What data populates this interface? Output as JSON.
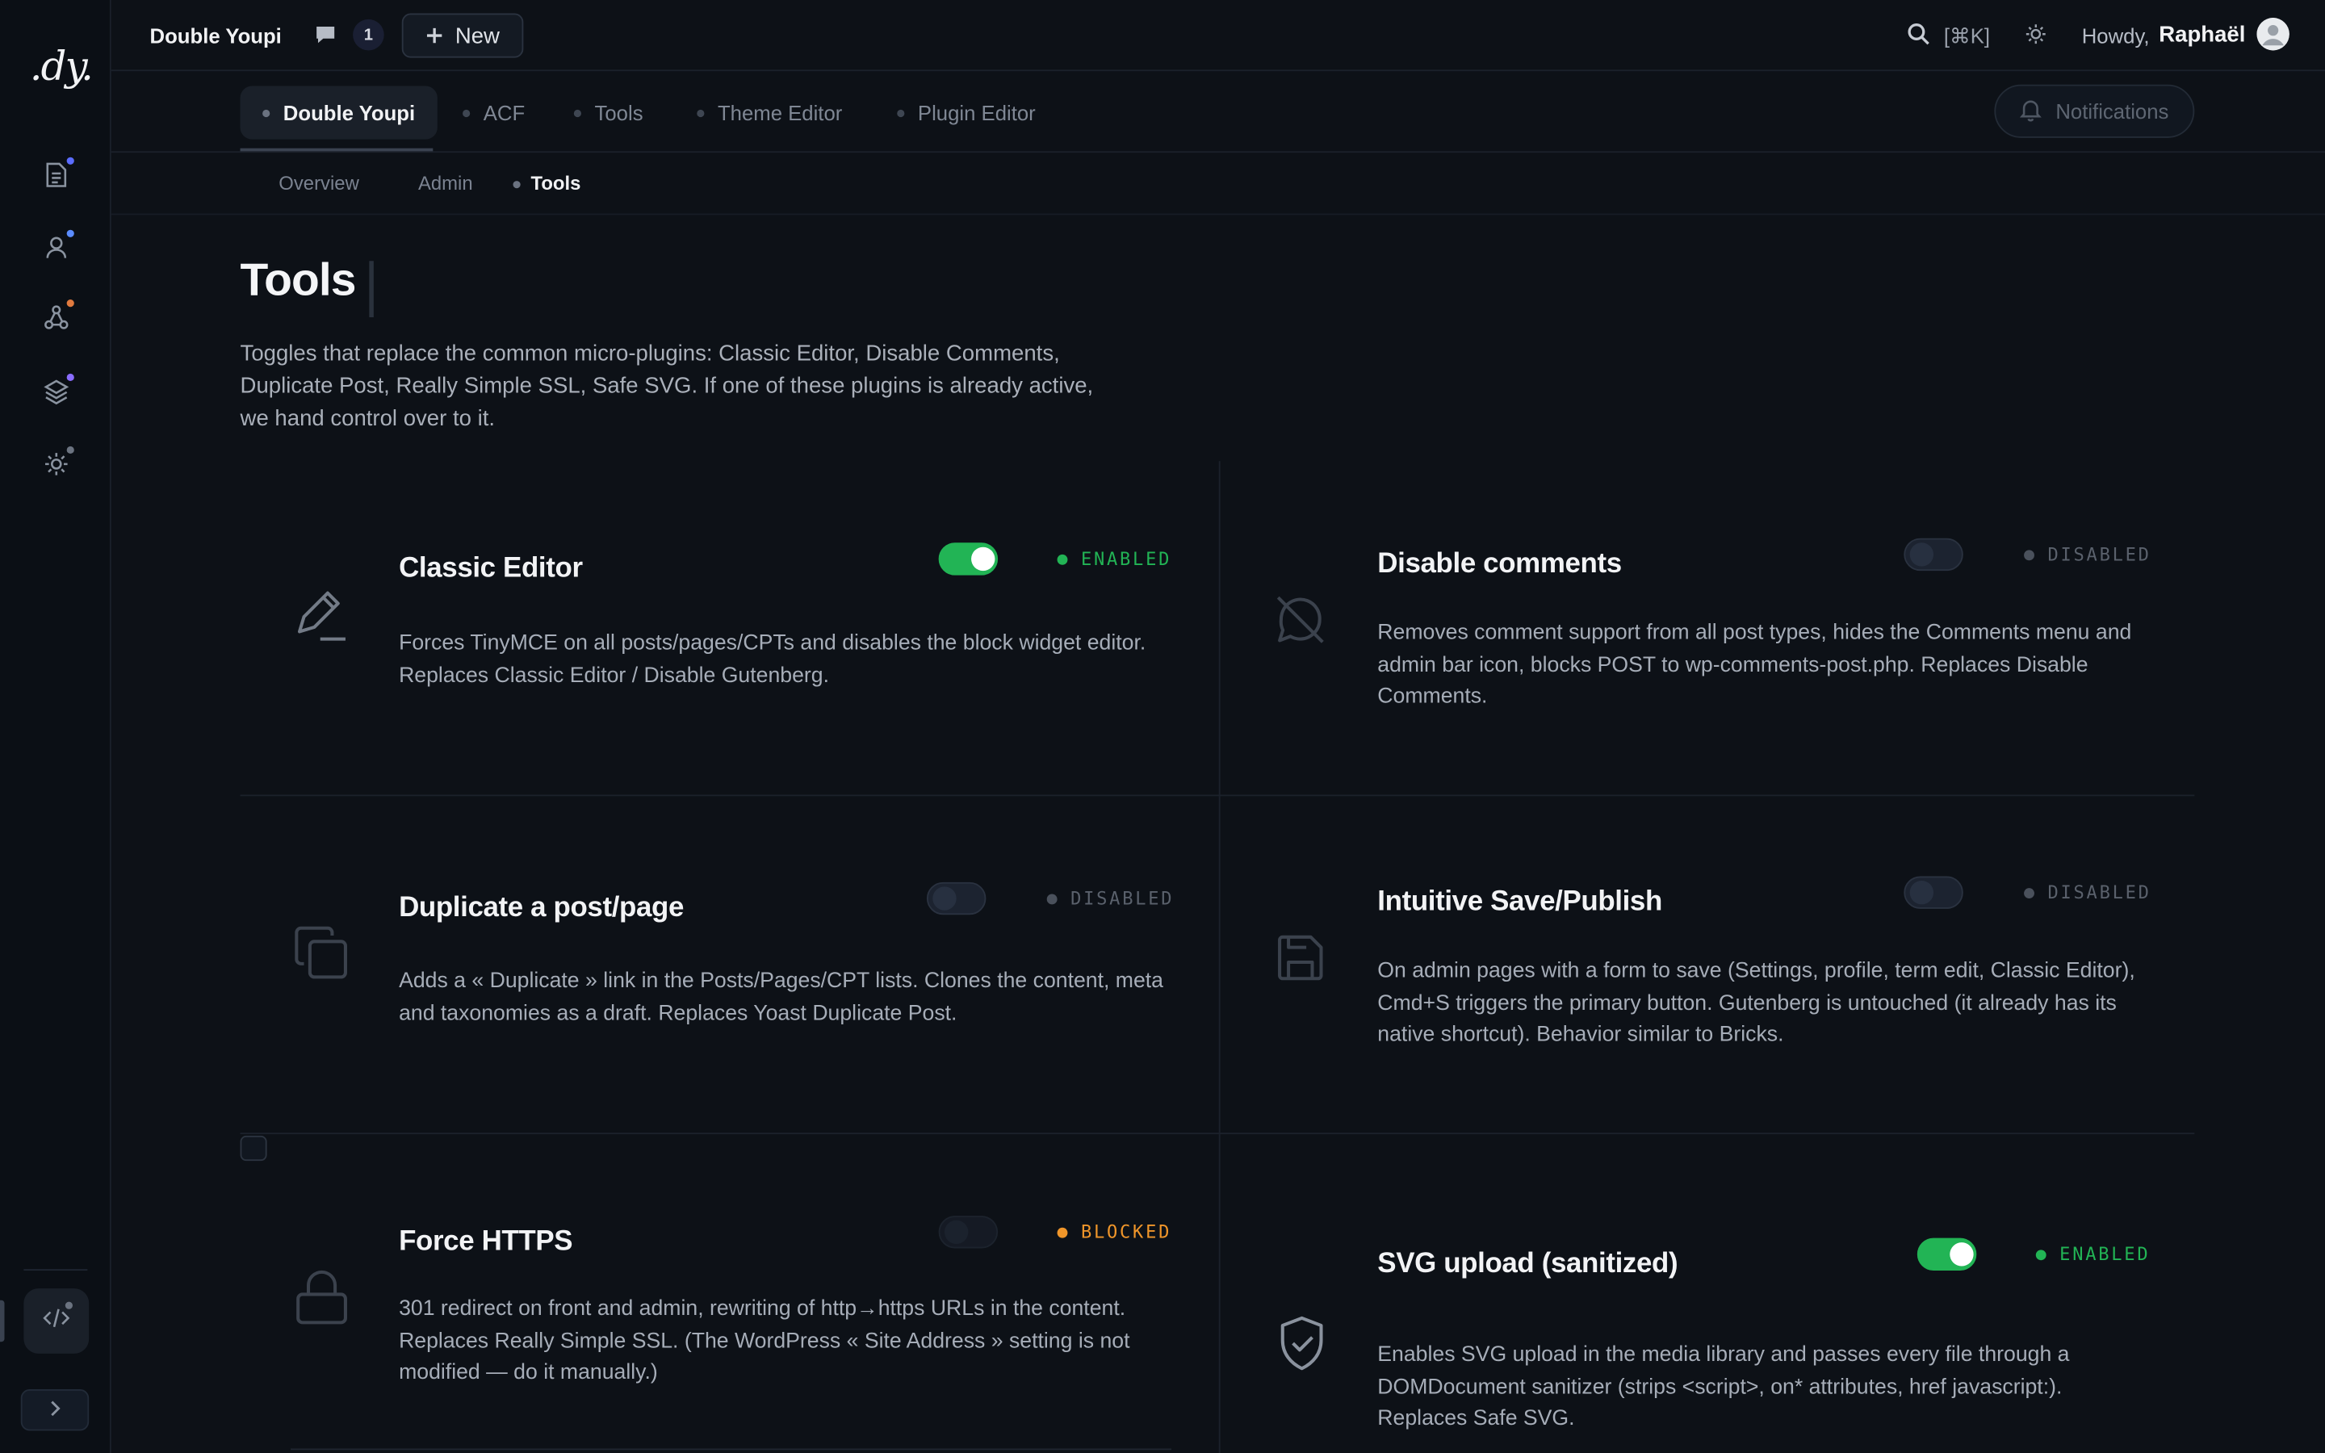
{
  "rail": {
    "logo": ".dy.",
    "items": [
      {
        "icon": "document-icon",
        "dot": "#5b6cff"
      },
      {
        "icon": "user-icon",
        "dot": "#5b8cff"
      },
      {
        "icon": "nodes-icon",
        "dot": "#e07a3f"
      },
      {
        "icon": "layers-icon",
        "dot": "#8a6cff"
      },
      {
        "icon": "gear-icon",
        "dot": "#6b7380"
      }
    ],
    "code_icon": "code-icon",
    "expand_icon": "chevron-right-icon"
  },
  "topbar": {
    "site_name": "Double Youpi",
    "comment_count": "1",
    "new_label": "New",
    "search_shortcut": "[⌘K]",
    "howdy": "Howdy,",
    "user_name": "Raphaël"
  },
  "tabs": {
    "items": [
      {
        "label": "Double Youpi",
        "active": true
      },
      {
        "label": "ACF",
        "active": false
      },
      {
        "label": "Tools",
        "active": false
      },
      {
        "label": "Theme Editor",
        "active": false
      },
      {
        "label": "Plugin Editor",
        "active": false
      }
    ],
    "notifications_label": "Notifications"
  },
  "subtabs": {
    "items": [
      {
        "label": "Overview",
        "active": false
      },
      {
        "label": "Admin",
        "active": false
      },
      {
        "label": "Tools",
        "active": true
      }
    ]
  },
  "page": {
    "title": "Tools",
    "description": "Toggles that replace the common micro-plugins: Classic Editor, Disable Comments, Duplicate Post, Really Simple SSL, Safe SVG. If one of these plugins is already active, we hand control over to it."
  },
  "colors": {
    "enabled": "#22b455",
    "disabled": "#5a616c",
    "blocked": "#f0962a"
  },
  "cards": [
    {
      "id": "classic-editor",
      "icon": "pencil-icon",
      "title": "Classic Editor",
      "description": "Forces TinyMCE on all posts/pages/CPTs and disables the block widget editor. Replaces Classic Editor / Disable Gutenberg.",
      "enabled": true,
      "status": "ENABLED"
    },
    {
      "id": "disable-comments",
      "icon": "comment-off-icon",
      "title": "Disable comments",
      "description": "Removes comment support from all post types, hides the Comments menu and admin bar icon, blocks POST to wp-comments-post.php. Replaces Disable Comments.",
      "enabled": false,
      "status": "DISABLED"
    },
    {
      "id": "duplicate-post",
      "icon": "copy-icon",
      "title": "Duplicate a post/page",
      "description": "Adds a « Duplicate » link in the Posts/Pages/CPT lists. Clones the content, meta and taxonomies as a draft. Replaces Yoast Duplicate Post.",
      "enabled": false,
      "status": "DISABLED"
    },
    {
      "id": "intuitive-save",
      "icon": "save-icon",
      "title": "Intuitive Save/Publish",
      "description": "On admin pages with a form to save (Settings, profile, term edit, Classic Editor), Cmd+S triggers the primary button. Gutenberg is untouched (it already has its native shortcut). Behavior similar to Bricks.",
      "enabled": false,
      "status": "DISABLED"
    },
    {
      "id": "force-https",
      "icon": "lock-icon",
      "title": "Force HTTPS",
      "description": "301 redirect on front and admin, rewriting of http→https URLs in the content. Replaces Really Simple SSL. (The WordPress « Site Address » setting is not modified — do it manually.)",
      "enabled": false,
      "status": "BLOCKED"
    },
    {
      "id": "svg-upload",
      "icon": "shield-check-icon",
      "title": "SVG upload (sanitized)",
      "description": "Enables SVG upload in the media library and passes every file through a DOMDocument sanitizer (strips <script>, on* attributes, href javascript:). Replaces Safe SVG.",
      "enabled": true,
      "status": "ENABLED"
    }
  ]
}
